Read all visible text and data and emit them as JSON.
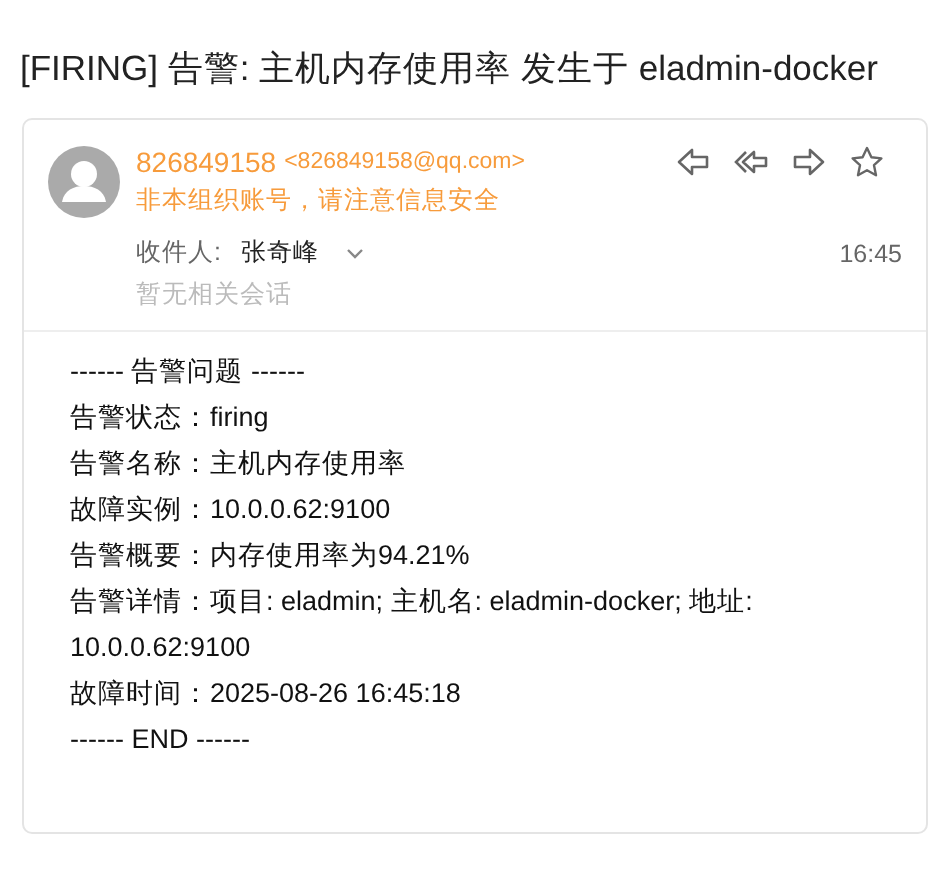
{
  "title": "[FIRING] 告警: 主机内存使用率 发生于 eladmin-docker",
  "email": {
    "sender_name": "826849158",
    "sender_address": "<826849158@qq.com>",
    "warning": "非本组织账号，请注意信息安全",
    "recipient_label": "收件人:",
    "recipient": "张奇峰",
    "time": "16:45",
    "conversation_note": "暂无相关会话",
    "body_lines": [
      "------ 告警问题 ------",
      "告警状态：firing",
      "告警名称：主机内存使用率",
      "故障实例：10.0.0.62:9100",
      "告警概要：内存使用率为94.21%",
      "告警详情：项目: eladmin; 主机名: eladmin-docker; 地址: 10.0.0.62:9100",
      "故障时间：2025-08-26 16:45:18",
      "------ END ------"
    ]
  }
}
